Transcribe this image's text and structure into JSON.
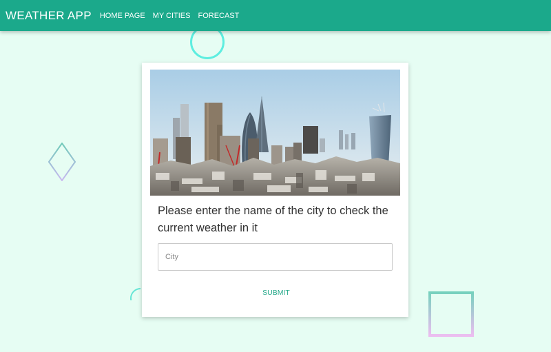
{
  "navbar": {
    "brand": "WEATHER APP",
    "links": [
      "HOME PAGE",
      "MY CITIES",
      "FORECAST"
    ],
    "background": "#1ba98b"
  },
  "card": {
    "image": "city-skyline-photo",
    "prompt": "Please enter the name of the city to check the current weather in it",
    "city_input": {
      "placeholder": "City",
      "value": ""
    },
    "submit_label": "SUBMIT",
    "accent": "#26a98a"
  },
  "decorations": [
    "circle-outline",
    "diamond-outline",
    "semicircle-outline",
    "square-outline"
  ]
}
